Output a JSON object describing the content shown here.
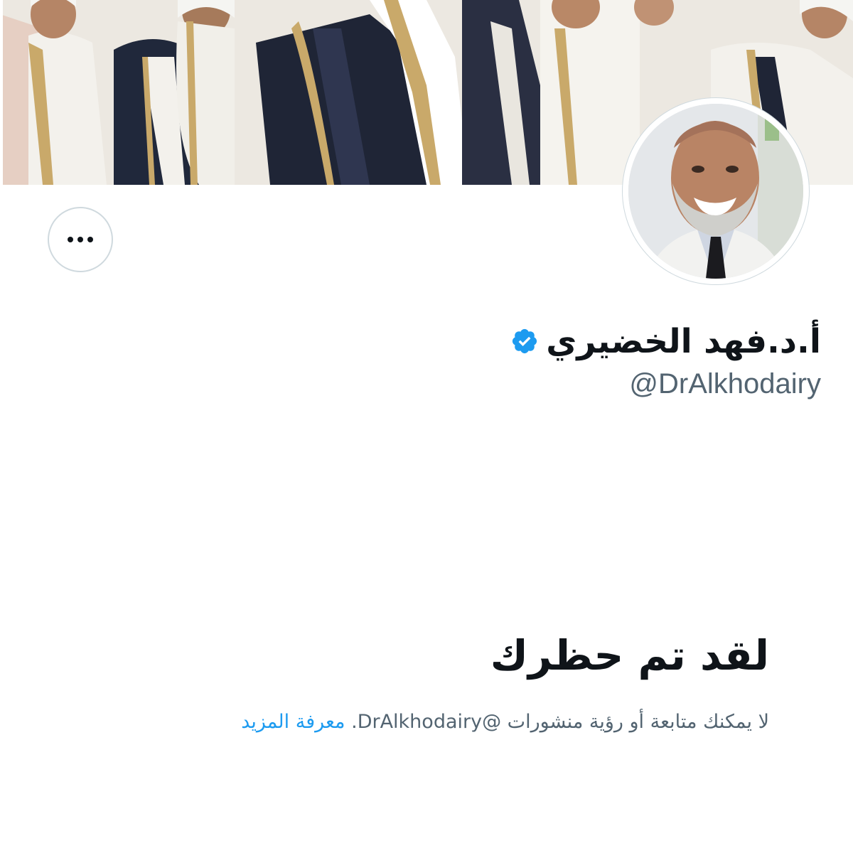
{
  "profile": {
    "display_name": "أ.د.فهد الخضيري",
    "handle": "@DrAlkhodairy",
    "verified": true
  },
  "icons": {
    "more": "more-horizontal-icon",
    "verified": "verified-badge-icon"
  },
  "blocked": {
    "title": "لقد تم حظرك",
    "message": "لا يمكنك متابعة أو رؤية منشورات @DrAlkhodairy.",
    "learn_more": "معرفة المزيد"
  },
  "colors": {
    "text_primary": "#0f1419",
    "text_secondary": "#536471",
    "link": "#1d9bf0",
    "verified": "#1d9bf0",
    "border": "#cfd9de"
  }
}
